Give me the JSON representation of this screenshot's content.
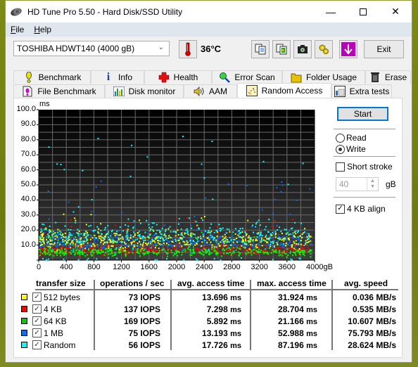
{
  "window": {
    "title": "HD Tune Pro 5.50 - Hard Disk/SSD Utility",
    "controls": [
      "minimize",
      "maximize",
      "close"
    ]
  },
  "menu": [
    {
      "label": "File",
      "accel": "F",
      "rest": "ile"
    },
    {
      "label": "Help",
      "accel": "H",
      "rest": "elp"
    }
  ],
  "toolbar": {
    "drive": "TOSHIBA HDWT140 (4000 gB)",
    "temperature": "36°C",
    "exit_label": "Exit",
    "icons": [
      "thermometer-icon",
      "copy-text-icon",
      "copy-screenshot-icon",
      "camera-icon",
      "options-icon",
      "download-icon"
    ]
  },
  "tabs": {
    "row1": [
      {
        "label": "Benchmark",
        "icon": "benchmark-icon"
      },
      {
        "label": "Info",
        "icon": "info-icon"
      },
      {
        "label": "Health",
        "icon": "health-icon"
      },
      {
        "label": "Error Scan",
        "icon": "error-scan-icon"
      },
      {
        "label": "Folder Usage",
        "icon": "folder-icon"
      },
      {
        "label": "Erase",
        "icon": "trash-icon"
      }
    ],
    "row2": [
      {
        "label": "File Benchmark",
        "icon": "file-benchmark-icon"
      },
      {
        "label": "Disk monitor",
        "icon": "disk-monitor-icon"
      },
      {
        "label": "AAM",
        "icon": "speaker-icon"
      },
      {
        "label": "Random Access",
        "icon": "random-access-icon",
        "active": true
      },
      {
        "label": "Extra tests",
        "icon": "extra-tests-icon"
      }
    ]
  },
  "controls": {
    "start_label": "Start",
    "read_label": "Read",
    "write_label": "Write",
    "mode_selected": "Write",
    "short_stroke_label": "Short stroke",
    "short_stroke_checked": false,
    "short_stroke_value": "40",
    "short_stroke_unit": "gB",
    "align_label": "4 KB align",
    "align_checked": true
  },
  "chart_data": {
    "type": "scatter",
    "title": "",
    "ylabel": "ms",
    "xlabel": "gB",
    "xlim": [
      0,
      4000
    ],
    "ylim": [
      0,
      100
    ],
    "x_ticks": [
      "0",
      "400",
      "800",
      "1200",
      "1600",
      "2000",
      "2400",
      "2800",
      "3200",
      "3600",
      "4000gB"
    ],
    "y_ticks": [
      "100.0",
      "90.0",
      "80.0",
      "70.0",
      "60.0",
      "50.0",
      "40.0",
      "30.0",
      "20.0",
      "10.0"
    ],
    "grid": true,
    "legend": "table-below",
    "series": [
      {
        "name": "512 bytes",
        "color": "#ffff00",
        "avg_ms": 13.696,
        "max_ms": 31.924
      },
      {
        "name": "4 KB",
        "color": "#ff0000",
        "avg_ms": 7.298,
        "max_ms": 28.704
      },
      {
        "name": "64 KB",
        "color": "#00ff00",
        "avg_ms": 5.892,
        "max_ms": 21.166
      },
      {
        "name": "1 MB",
        "color": "#0070ff",
        "avg_ms": 13.193,
        "max_ms": 52.988
      },
      {
        "name": "Random",
        "color": "#00ffff",
        "avg_ms": 17.726,
        "max_ms": 87.196
      }
    ]
  },
  "results": {
    "headers": [
      "transfer size",
      "operations / sec",
      "avg. access time",
      "max. access time",
      "avg. speed"
    ],
    "rows": [
      {
        "name": "512 bytes",
        "color": "#ffff00",
        "checked": true,
        "ops": "73 IOPS",
        "avg": "13.696",
        "max": "31.924",
        "speed": "0.036 MB/s"
      },
      {
        "name": "4 KB",
        "color": "#ff0000",
        "checked": true,
        "ops": "137 IOPS",
        "avg": "7.298",
        "max": "28.704",
        "speed": "0.535 MB/s"
      },
      {
        "name": "64 KB",
        "color": "#00cc00",
        "checked": true,
        "ops": "169 IOPS",
        "avg": "5.892",
        "max": "21.166",
        "speed": "10.607 MB/s"
      },
      {
        "name": "1 MB",
        "color": "#0070ff",
        "checked": true,
        "ops": "75 IOPS",
        "avg": "13.193",
        "max": "52.988",
        "speed": "75.793 MB/s"
      },
      {
        "name": "Random",
        "color": "#00ffff",
        "checked": true,
        "ops": "56 IOPS",
        "avg": "17.726",
        "max": "87.196",
        "speed": "28.624 MB/s"
      }
    ],
    "ms_unit": "ms"
  }
}
